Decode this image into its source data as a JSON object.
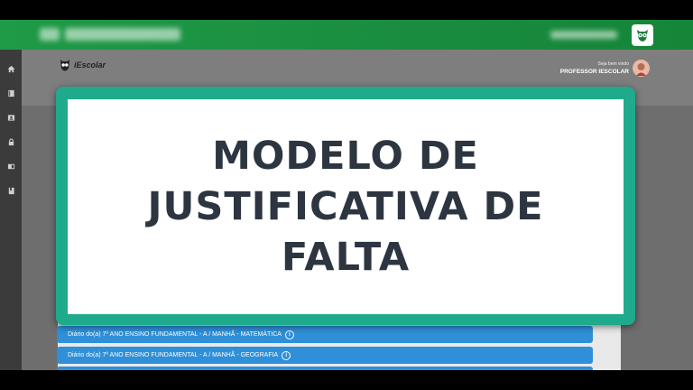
{
  "app": {
    "brand_name": "iEscolar",
    "welcome_text": "Seja bem vindo",
    "user_name": "PROFESSOR IESCOLAR"
  },
  "banner": {
    "lines": [
      "MODELO DE",
      "JUSTIFICATIVA DE",
      "FALTA"
    ]
  },
  "diaries": [
    {
      "label": "Diário do(a) 7º ANO ENSINO FUNDAMENTAL - A / MANHÃ - MATEMÁTICA"
    },
    {
      "label": "Diário do(a) 7º ANO ENSINO FUNDAMENTAL - A / MANHÃ - GEOGRAFIA"
    },
    {
      "label": ""
    }
  ],
  "sidebar": {
    "icons": [
      "home-icon",
      "book-icon",
      "id-card-icon",
      "lock-icon",
      "card-icon",
      "bookmark-book-icon"
    ]
  },
  "colors": {
    "topbar": "#1f9a46",
    "banner_frame": "#1faa8c",
    "banner_text": "#2c3540",
    "diary_row": "#2f8fd8",
    "sidebar": "#3b3b3b"
  }
}
